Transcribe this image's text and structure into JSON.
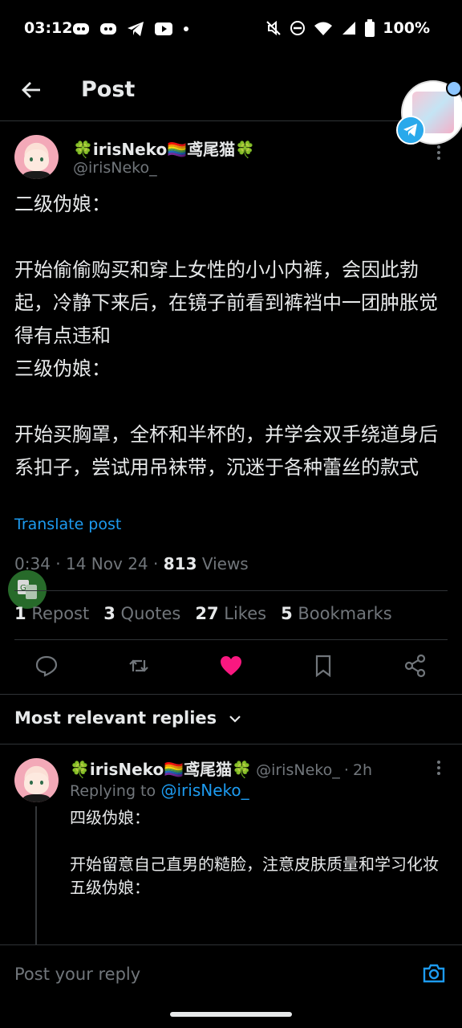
{
  "status_bar": {
    "time": "03:12",
    "battery": "100%",
    "left_icons": [
      "discord-icon",
      "discord-icon",
      "telegram-icon",
      "youtube-icon",
      "dot-icon"
    ],
    "right_icons": [
      "mute-icon",
      "dnd-icon",
      "wifi-icon",
      "signal-icon",
      "battery-icon"
    ]
  },
  "header": {
    "title": "Post"
  },
  "post": {
    "author_name": "🍀irisNeko🏳️‍🌈鸢尾猫🍀",
    "author_handle": "@irisNeko_",
    "text": "二级伪娘：\n\n开始偷偷购买和穿上女性的小小内裤，会因此勃起，冷静下来后，在镜子前看到裤裆中一团肿胀觉得有点违和\n三级伪娘：\n\n开始买胸罩，全杯和半杯的，并学会双手绕道身后系扣子，尝试用吊袜带，沉迷于各种蕾丝的款式",
    "translate_label": "Translate post",
    "time": "0:34",
    "date": "14 Nov 24",
    "views_count": "813",
    "views_label": "Views",
    "stats": {
      "reposts_count": "1",
      "reposts_label": "Repost",
      "quotes_count": "3",
      "quotes_label": "Quotes",
      "likes_count": "27",
      "likes_label": "Likes",
      "bookmarks_count": "5",
      "bookmarks_label": "Bookmarks"
    },
    "liked": true
  },
  "replies": {
    "header": "Most relevant replies",
    "items": [
      {
        "author_name": "🍀irisNeko🏳️‍🌈鸢尾猫🍀",
        "author_handle": "@irisNeko_",
        "age": "2h",
        "replying_to_label": "Replying to",
        "replying_to_handle": "@irisNeko_",
        "text": "四级伪娘：\n\n开始留意自己直男的糙脸，注意皮肤质量和学习化妆\n五级伪娘："
      }
    ]
  },
  "composer": {
    "placeholder": "Post your reply"
  },
  "colors": {
    "accent": "#1d9bf0",
    "like": "#f91880",
    "background": "#000000",
    "muted": "#71767b"
  }
}
